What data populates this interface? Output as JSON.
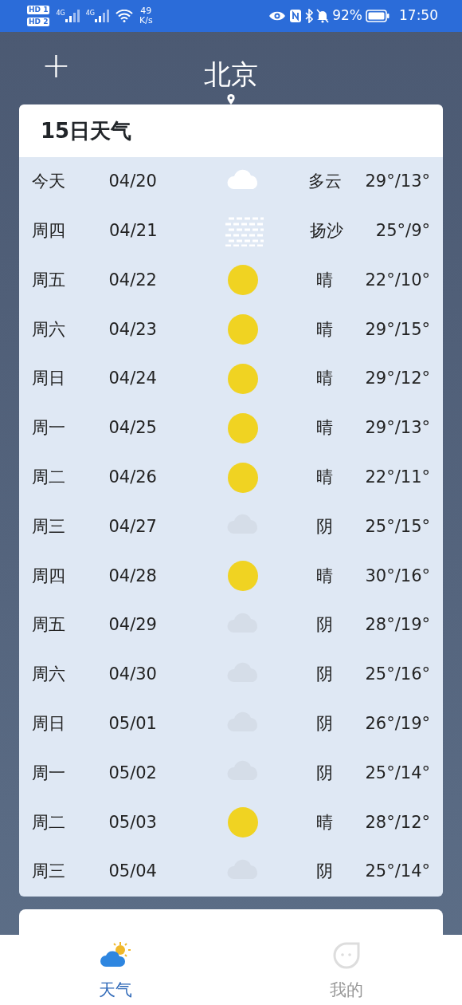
{
  "status_bar": {
    "sims": [
      {
        "label": "HD",
        "slot": "1",
        "network": "4G"
      },
      {
        "label": "HD",
        "slot": "2",
        "network": "4G"
      }
    ],
    "speed_value": "49",
    "speed_unit": "K/s",
    "battery": "92%",
    "time": "17:50"
  },
  "header": {
    "add": "+",
    "city": "北京"
  },
  "forecast": {
    "title": "15日天气",
    "days": [
      {
        "day": "今天",
        "date": "04/20",
        "kind": "cloudy",
        "condition": "多云",
        "temp": "29°/13°"
      },
      {
        "day": "周四",
        "date": "04/21",
        "kind": "dust",
        "condition": "扬沙",
        "temp": "25°/9°"
      },
      {
        "day": "周五",
        "date": "04/22",
        "kind": "sunny",
        "condition": "晴",
        "temp": "22°/10°"
      },
      {
        "day": "周六",
        "date": "04/23",
        "kind": "sunny",
        "condition": "晴",
        "temp": "29°/15°"
      },
      {
        "day": "周日",
        "date": "04/24",
        "kind": "sunny",
        "condition": "晴",
        "temp": "29°/12°"
      },
      {
        "day": "周一",
        "date": "04/25",
        "kind": "sunny",
        "condition": "晴",
        "temp": "29°/13°"
      },
      {
        "day": "周二",
        "date": "04/26",
        "kind": "sunny",
        "condition": "晴",
        "temp": "22°/11°"
      },
      {
        "day": "周三",
        "date": "04/27",
        "kind": "overcast",
        "condition": "阴",
        "temp": "25°/15°"
      },
      {
        "day": "周四",
        "date": "04/28",
        "kind": "sunny",
        "condition": "晴",
        "temp": "30°/16°"
      },
      {
        "day": "周五",
        "date": "04/29",
        "kind": "overcast",
        "condition": "阴",
        "temp": "28°/19°"
      },
      {
        "day": "周六",
        "date": "04/30",
        "kind": "overcast",
        "condition": "阴",
        "temp": "25°/16°"
      },
      {
        "day": "周日",
        "date": "05/01",
        "kind": "overcast",
        "condition": "阴",
        "temp": "26°/19°"
      },
      {
        "day": "周一",
        "date": "05/02",
        "kind": "overcast",
        "condition": "阴",
        "temp": "25°/14°"
      },
      {
        "day": "周二",
        "date": "05/03",
        "kind": "sunny",
        "condition": "晴",
        "temp": "28°/12°"
      },
      {
        "day": "周三",
        "date": "05/04",
        "kind": "overcast",
        "condition": "阴",
        "temp": "25°/14°"
      }
    ]
  },
  "bottom_nav": [
    {
      "label": "天气",
      "kind": "weather",
      "selected": true
    },
    {
      "label": "我的",
      "kind": "me",
      "selected": false
    }
  ]
}
